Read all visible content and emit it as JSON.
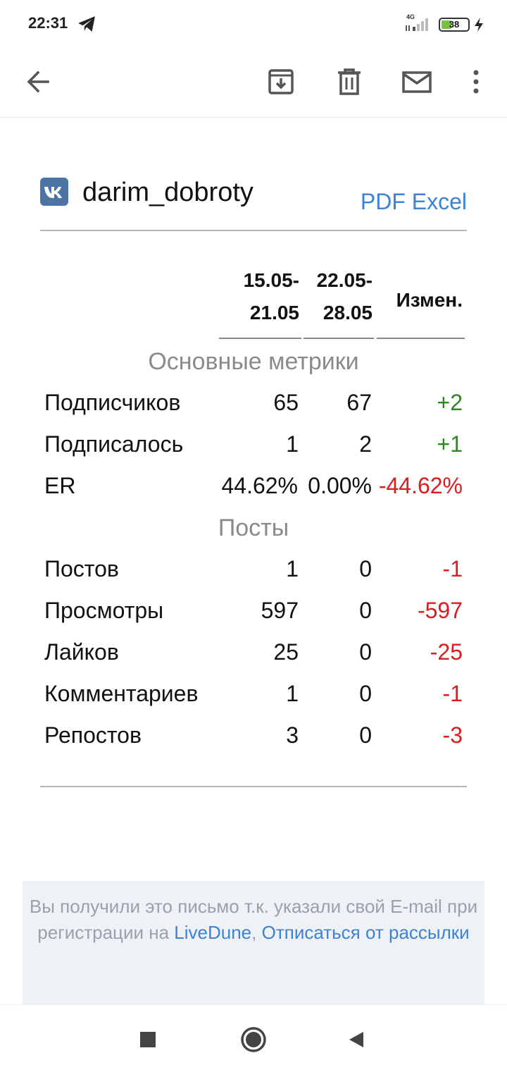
{
  "status_bar": {
    "time": "22:31",
    "network": "4G",
    "battery": "38",
    "battery_level": 0.38
  },
  "email": {
    "account_name": "darim_dobroty",
    "export_pdf": "PDF",
    "export_excel": "Excel",
    "columns": {
      "period1_line1": "15.05-",
      "period1_line2": "21.05",
      "period2_line1": "22.05-",
      "period2_line2": "28.05",
      "change": "Измен."
    },
    "sections": [
      {
        "title": "Основные метрики",
        "rows": [
          {
            "label": "Подписчиков",
            "v1": "65",
            "v2": "67",
            "change": "+2"
          },
          {
            "label": "Подписалось",
            "v1": "1",
            "v2": "2",
            "change": "+1"
          },
          {
            "label": "ER",
            "v1": "44.62%",
            "v2": "0.00%",
            "change": "-44.62%"
          }
        ]
      },
      {
        "title": "Посты",
        "rows": [
          {
            "label": "Постов",
            "v1": "1",
            "v2": "0",
            "change": "-1"
          },
          {
            "label": "Просмотры",
            "v1": "597",
            "v2": "0",
            "change": "-597"
          },
          {
            "label": "Лайков",
            "v1": "25",
            "v2": "0",
            "change": "-25"
          },
          {
            "label": "Комментариев",
            "v1": "1",
            "v2": "0",
            "change": "-1"
          },
          {
            "label": "Репостов",
            "v1": "3",
            "v2": "0",
            "change": "-3"
          }
        ]
      }
    ],
    "footer": {
      "text1": "Вы получили это письмо т.к. указали свой E-mail при регистрации на",
      "link_livedune": "LiveDune",
      "comma": ",",
      "link_unsubscribe": "Отписаться от рассылки"
    }
  },
  "colors": {
    "link": "#3d82d3",
    "positive": "#2a8a1f",
    "negative": "#dd1d1d",
    "vk": "#4c75a3"
  },
  "icons": [
    "telegram-icon",
    "signal-icon",
    "battery-icon",
    "charging-icon",
    "back-arrow-icon",
    "archive-icon",
    "trash-icon",
    "mail-icon",
    "more-vert-icon",
    "vk-logo-icon",
    "stop-square-icon",
    "home-circle-icon",
    "back-triangle-icon"
  ]
}
